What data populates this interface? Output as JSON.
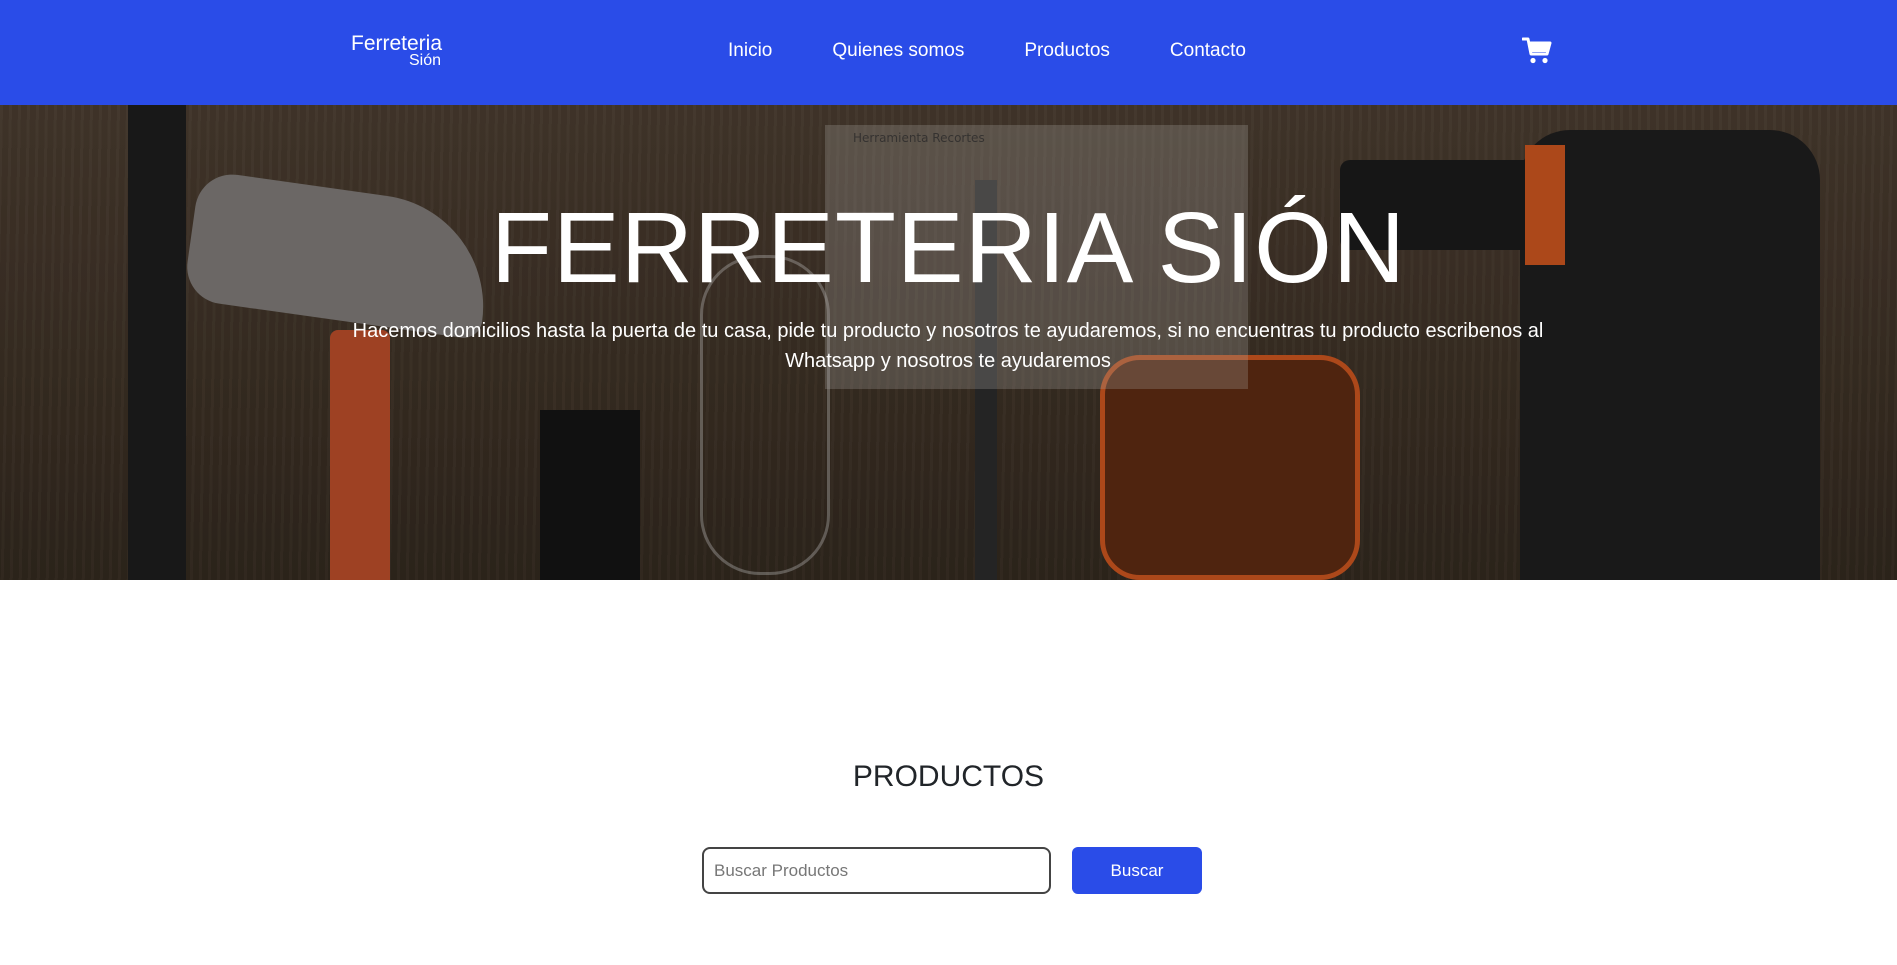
{
  "colors": {
    "primary": "#2a4ce8",
    "text_dark": "#212529",
    "white": "#ffffff"
  },
  "header": {
    "brand_main": "Ferreteria",
    "brand_sub": "Sión",
    "nav": [
      {
        "label": "Inicio"
      },
      {
        "label": "Quienes somos"
      },
      {
        "label": "Productos"
      },
      {
        "label": "Contacto"
      }
    ],
    "cart_icon": "shopping-cart-icon"
  },
  "hero": {
    "title": "FERRETERIA SIÓN",
    "subtitle": "Hacemos domicilios hasta la puerta de tu casa, pide tu producto y nosotros te ayudaremos, si no encuentras tu producto escribenos al Whatsapp y nosotros te ayudaremos",
    "overlay_label": "Herramienta Recortes"
  },
  "products": {
    "title": "PRODUCTOS",
    "search_placeholder": "Buscar Productos",
    "search_button": "Buscar"
  }
}
